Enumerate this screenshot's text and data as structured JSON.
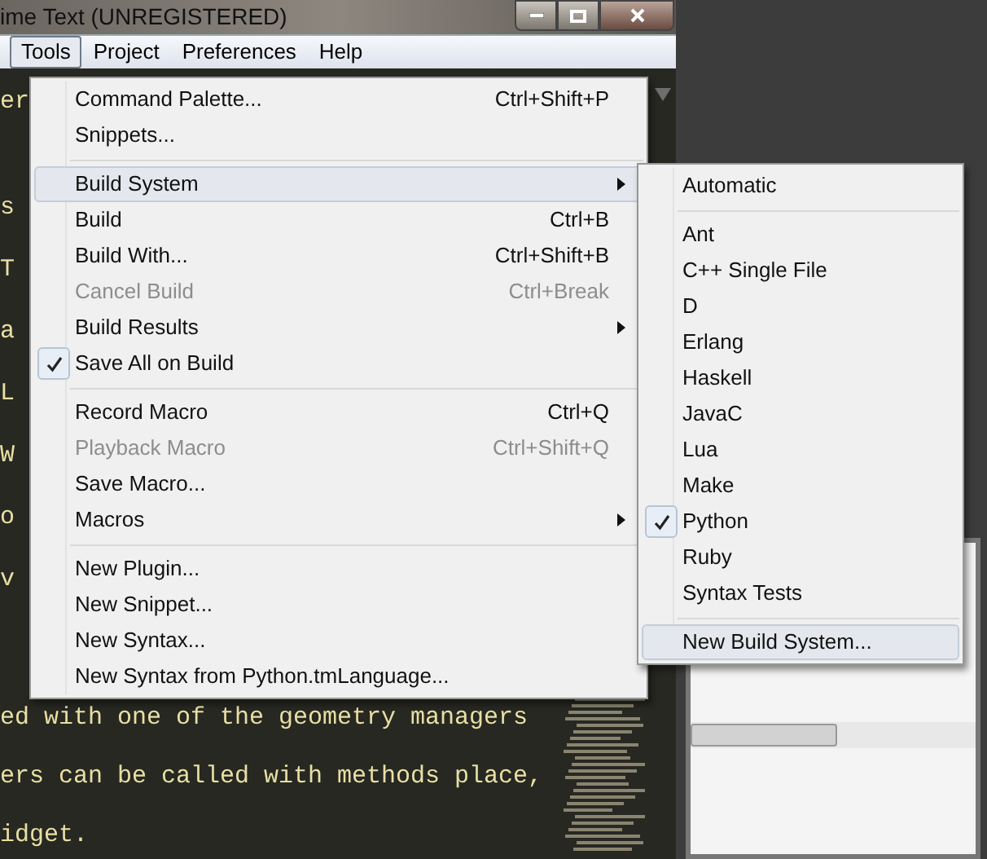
{
  "window": {
    "title": "ime Text (UNREGISTERED)"
  },
  "menu_bar": [
    {
      "label": "Tools",
      "selected": true
    },
    {
      "label": "Project",
      "selected": false
    },
    {
      "label": "Preferences",
      "selected": false
    },
    {
      "label": "Help",
      "selected": false
    }
  ],
  "editor": {
    "lines_top": [
      "er",
      "s",
      "T",
      "a",
      "L",
      "W",
      "o",
      "v"
    ],
    "lines_bottom": [
      "ed with one of the geometry managers",
      "ers can be called with methods place,",
      "idget."
    ]
  },
  "tools_menu": [
    {
      "kind": "item",
      "label": "Command Palette...",
      "shortcut": "Ctrl+Shift+P",
      "disabled": false,
      "checked": false,
      "selected": false,
      "submenu": false
    },
    {
      "kind": "item",
      "label": "Snippets...",
      "disabled": false,
      "checked": false,
      "selected": false,
      "submenu": false
    },
    {
      "kind": "separator"
    },
    {
      "kind": "item",
      "label": "Build System",
      "disabled": false,
      "checked": false,
      "selected": true,
      "submenu": true
    },
    {
      "kind": "item",
      "label": "Build",
      "shortcut": "Ctrl+B",
      "disabled": false,
      "checked": false,
      "selected": false,
      "submenu": false
    },
    {
      "kind": "item",
      "label": "Build With...",
      "shortcut": "Ctrl+Shift+B",
      "disabled": false,
      "checked": false,
      "selected": false,
      "submenu": false
    },
    {
      "kind": "item",
      "label": "Cancel Build",
      "shortcut": "Ctrl+Break",
      "disabled": true,
      "checked": false,
      "selected": false,
      "submenu": false
    },
    {
      "kind": "item",
      "label": "Build Results",
      "disabled": false,
      "checked": false,
      "selected": false,
      "submenu": true
    },
    {
      "kind": "item",
      "label": "Save All on Build",
      "disabled": false,
      "checked": true,
      "selected": false,
      "submenu": false
    },
    {
      "kind": "separator"
    },
    {
      "kind": "item",
      "label": "Record Macro",
      "shortcut": "Ctrl+Q",
      "disabled": false,
      "checked": false,
      "selected": false,
      "submenu": false
    },
    {
      "kind": "item",
      "label": "Playback Macro",
      "shortcut": "Ctrl+Shift+Q",
      "disabled": true,
      "checked": false,
      "selected": false,
      "submenu": false
    },
    {
      "kind": "item",
      "label": "Save Macro...",
      "disabled": false,
      "checked": false,
      "selected": false,
      "submenu": false
    },
    {
      "kind": "item",
      "label": "Macros",
      "disabled": false,
      "checked": false,
      "selected": false,
      "submenu": true
    },
    {
      "kind": "separator"
    },
    {
      "kind": "item",
      "label": "New Plugin...",
      "disabled": false,
      "checked": false,
      "selected": false,
      "submenu": false
    },
    {
      "kind": "item",
      "label": "New Snippet...",
      "disabled": false,
      "checked": false,
      "selected": false,
      "submenu": false
    },
    {
      "kind": "item",
      "label": "New Syntax...",
      "disabled": false,
      "checked": false,
      "selected": false,
      "submenu": false
    },
    {
      "kind": "item",
      "label": "New Syntax from Python.tmLanguage...",
      "disabled": false,
      "checked": false,
      "selected": false,
      "submenu": false
    }
  ],
  "build_system_menu": [
    {
      "kind": "item",
      "label": "Automatic",
      "checked": false,
      "selected": false
    },
    {
      "kind": "separator"
    },
    {
      "kind": "item",
      "label": "Ant",
      "checked": false,
      "selected": false
    },
    {
      "kind": "item",
      "label": "C++ Single File",
      "checked": false,
      "selected": false
    },
    {
      "kind": "item",
      "label": "D",
      "checked": false,
      "selected": false
    },
    {
      "kind": "item",
      "label": "Erlang",
      "checked": false,
      "selected": false
    },
    {
      "kind": "item",
      "label": "Haskell",
      "checked": false,
      "selected": false
    },
    {
      "kind": "item",
      "label": "JavaC",
      "checked": false,
      "selected": false
    },
    {
      "kind": "item",
      "label": "Lua",
      "checked": false,
      "selected": false
    },
    {
      "kind": "item",
      "label": "Make",
      "checked": false,
      "selected": false
    },
    {
      "kind": "item",
      "label": "Python",
      "checked": true,
      "selected": false
    },
    {
      "kind": "item",
      "label": "Ruby",
      "checked": false,
      "selected": false
    },
    {
      "kind": "item",
      "label": "Syntax Tests",
      "checked": false,
      "selected": false
    },
    {
      "kind": "separator"
    },
    {
      "kind": "item",
      "label": "New Build System...",
      "checked": false,
      "selected": true
    }
  ]
}
